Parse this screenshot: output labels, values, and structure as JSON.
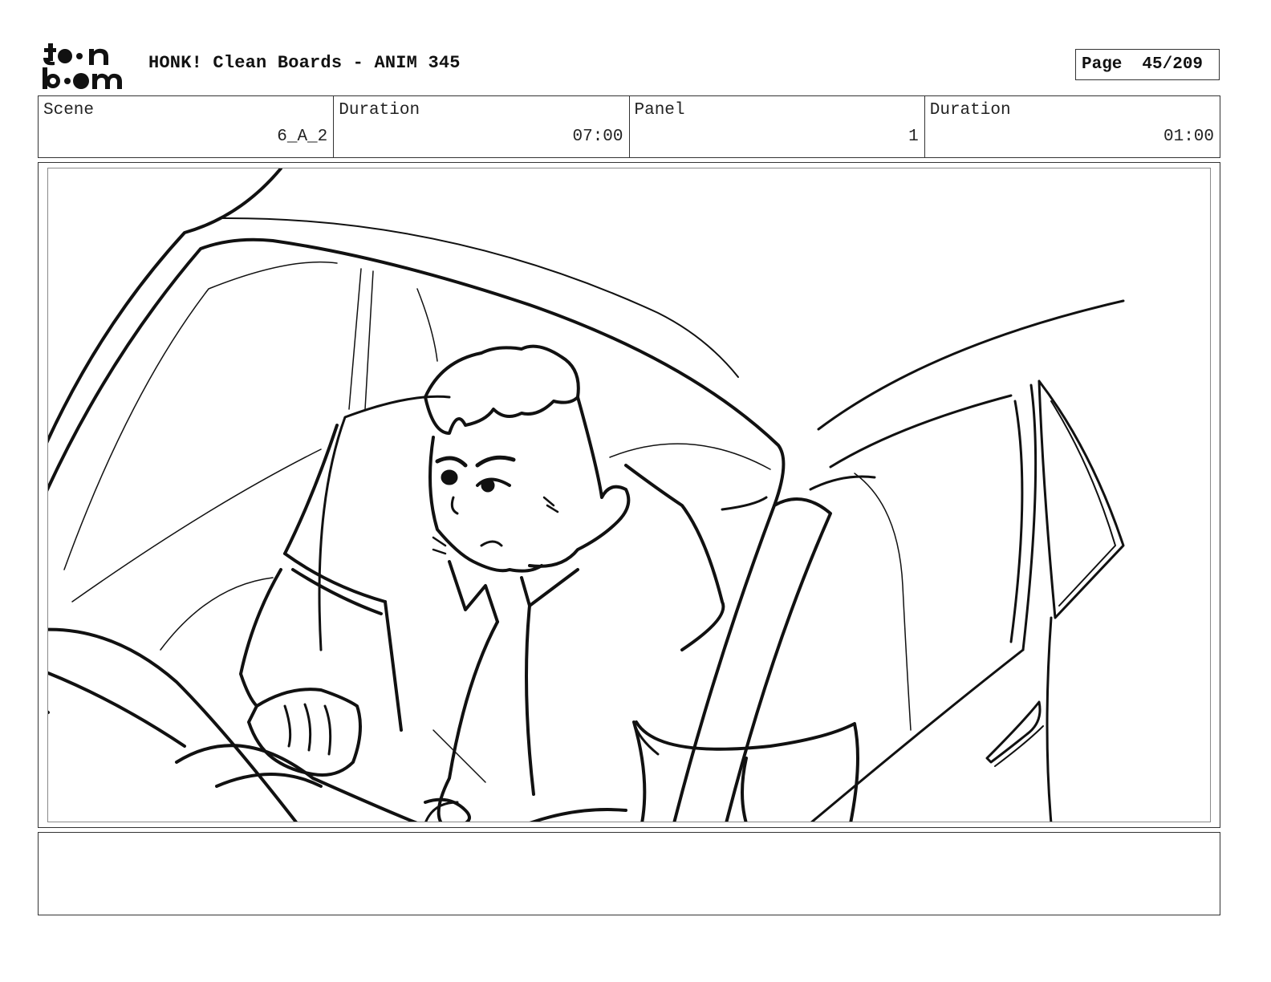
{
  "header": {
    "logo_text": "toon boom",
    "title": "HONK! Clean Boards - ANIM 345",
    "page_label": "Page",
    "page_number": "45/209"
  },
  "info": {
    "scene_label": "Scene",
    "scene_value": "6_A_2",
    "duration_label": "Duration",
    "duration_value": "07:00",
    "panel_label": "Panel",
    "panel_value": "1",
    "panel_duration_label": "Duration",
    "panel_duration_value": "01:00"
  },
  "panel": {
    "drawing": "man-driving-car-sketch"
  },
  "notes": {
    "text": ""
  }
}
